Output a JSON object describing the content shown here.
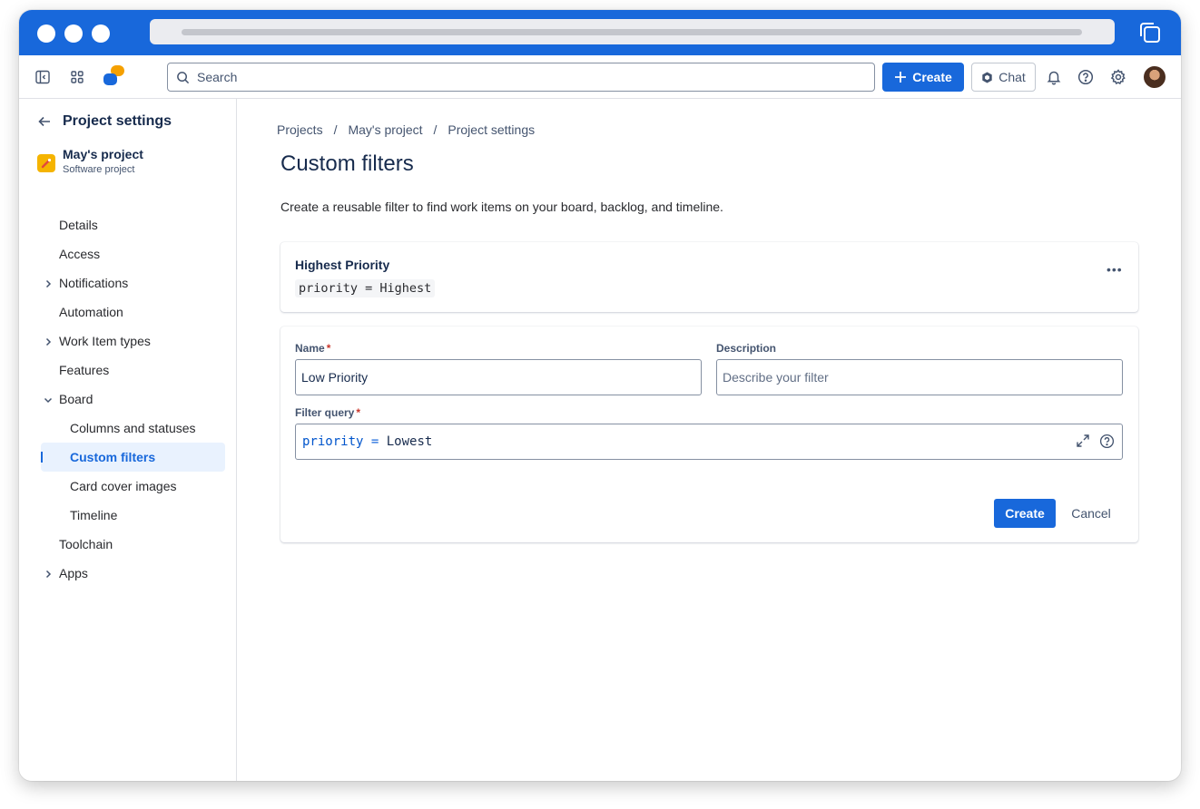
{
  "topnav": {
    "search_placeholder": "Search",
    "create_label": "Create",
    "chat_label": "Chat"
  },
  "sidebar": {
    "title": "Project settings",
    "project_name": "May's project",
    "project_type": "Software project",
    "items": [
      {
        "label": "Details"
      },
      {
        "label": "Access"
      },
      {
        "label": "Notifications"
      },
      {
        "label": "Automation"
      },
      {
        "label": "Work Item types"
      },
      {
        "label": "Features"
      },
      {
        "label": "Board"
      },
      {
        "label": "Columns and statuses"
      },
      {
        "label": "Custom filters"
      },
      {
        "label": "Card cover images"
      },
      {
        "label": "Timeline"
      },
      {
        "label": "Toolchain"
      },
      {
        "label": "Apps"
      }
    ]
  },
  "breadcrumb": {
    "items": [
      "Projects",
      "May's project",
      "Project settings"
    ],
    "separator": "/"
  },
  "page": {
    "title": "Custom filters",
    "description": "Create a reusable filter to find work items on your board, backlog, and timeline."
  },
  "existing_filter": {
    "name": "Highest Priority",
    "query": "priority = Highest",
    "more_label": "•••"
  },
  "form": {
    "name_label": "Name",
    "name_value": "Low Priority",
    "description_label": "Description",
    "description_placeholder": "Describe your filter",
    "query_label": "Filter query",
    "required_marker": "*",
    "query_keyword": "priority",
    "query_operator": "=",
    "query_value": "Lowest",
    "create_label": "Create",
    "cancel_label": "Cancel"
  },
  "colors": {
    "brand_blue": "#1868db",
    "selected_bg": "#e9f2fe",
    "required_red": "#c9372c"
  }
}
